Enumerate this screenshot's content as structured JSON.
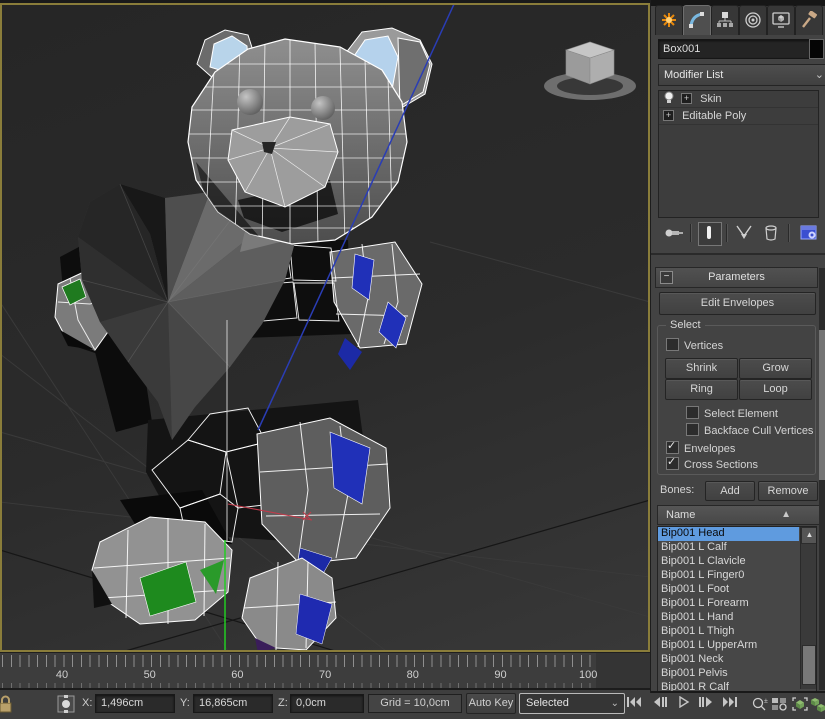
{
  "panel": {
    "tabs": [
      {
        "icon": "create-icon"
      },
      {
        "icon": "modify-icon",
        "active": true
      },
      {
        "icon": "hierarchy-icon"
      },
      {
        "icon": "motion-icon"
      },
      {
        "icon": "display-icon"
      },
      {
        "icon": "utilities-icon"
      }
    ],
    "object_name": "Box001",
    "modifier_list_label": "Modifier List",
    "stack": {
      "items": [
        {
          "label": "Skin",
          "bulb": true,
          "expand": "+"
        },
        {
          "label": "Editable Poly",
          "expand": "+"
        }
      ]
    },
    "stack_tools": [
      "pin-stack-icon",
      "show-end-result-icon",
      "make-unique-icon",
      "remove-modifier-icon",
      "configure-modifier-sets-icon"
    ],
    "parameters_title": "Parameters",
    "edit_envelopes_label": "Edit Envelopes",
    "select": {
      "title": "Select",
      "vertices": {
        "label": "Vertices",
        "checked": false
      },
      "shrink_label": "Shrink",
      "grow_label": "Grow",
      "ring_label": "Ring",
      "loop_label": "Loop",
      "select_element": {
        "label": "Select Element",
        "checked": false
      },
      "backface": {
        "label": "Backface Cull Vertices",
        "checked": false
      },
      "envelopes": {
        "label": "Envelopes",
        "checked": true
      },
      "cross_sections": {
        "label": "Cross Sections",
        "checked": true
      }
    },
    "bones": {
      "label": "Bones:",
      "add_label": "Add",
      "remove_label": "Remove",
      "name_header": "Name",
      "sort_icon": "sort-ascending-icon",
      "selected_index": 0,
      "items": [
        "Bip001 Head",
        "Bip001 L Calf",
        "Bip001 L Clavicle",
        "Bip001 L Finger0",
        "Bip001 L Foot",
        "Bip001 L Forearm",
        "Bip001 L Hand",
        "Bip001 L Thigh",
        "Bip001 L UpperArm",
        "Bip001 Neck",
        "Bip001 Pelvis",
        "Bip001 R Calf"
      ]
    }
  },
  "viewport": {
    "content": "wireframe teddy bear model holding a heart, skin envelope display",
    "viewcube": "viewcube-gizmo"
  },
  "timeline": {
    "labels": [
      "40",
      "50",
      "60",
      "70",
      "80",
      "90",
      "100"
    ]
  },
  "status_bar": {
    "lock_icon": "lock-selection-icon",
    "mode_icon": "absolute-mode-icon",
    "x_label": "X:",
    "x_value": "1,496cm",
    "y_label": "Y:",
    "y_value": "16,865cm",
    "z_label": "Z:",
    "z_value": "0,0cm",
    "grid_label": "Grid = 10,0cm",
    "auto_key_label": "Auto Key",
    "selection_filter_value": "Selected",
    "playback_icons": [
      "go-to-start-icon",
      "previous-frame-icon",
      "play-icon",
      "next-frame-icon",
      "go-to-end-icon"
    ],
    "nav_icons": [
      "zoom-icon",
      "zoom-all-icon",
      "zoom-extents-icon",
      "zoom-extents-all-icon"
    ]
  },
  "colors": {
    "viewport_border": "#8a7d3a",
    "selection_highlight": "#5f9bdf",
    "envelope_blue": "#2a3db5",
    "weight_green": "#1e8a1e",
    "weight_blue": "#2030b8"
  }
}
